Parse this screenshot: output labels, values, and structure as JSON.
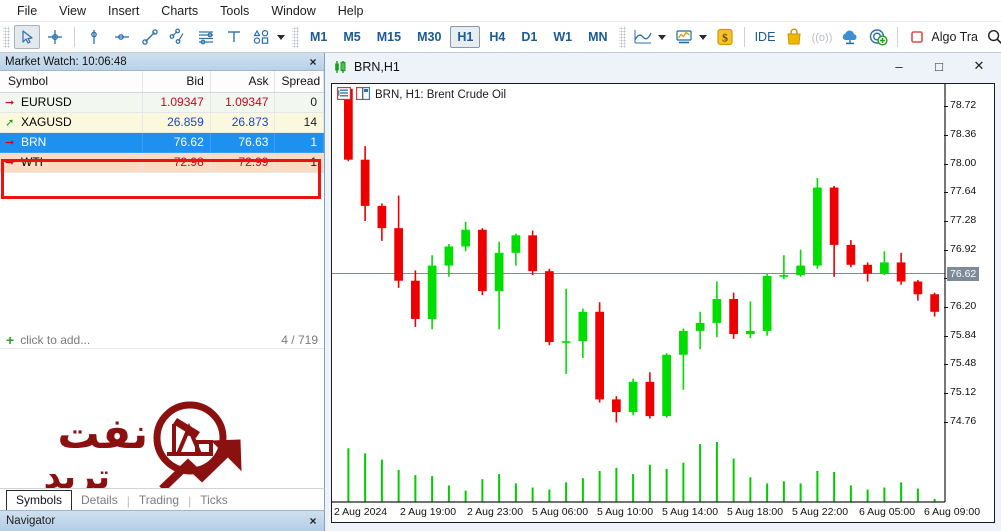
{
  "menubar": {
    "items": [
      {
        "label": "File",
        "name": "menu-file"
      },
      {
        "label": "View",
        "name": "menu-view"
      },
      {
        "label": "Insert",
        "name": "menu-insert"
      },
      {
        "label": "Charts",
        "name": "menu-charts"
      },
      {
        "label": "Tools",
        "name": "menu-tools"
      },
      {
        "label": "Window",
        "name": "menu-window"
      },
      {
        "label": "Help",
        "name": "menu-help"
      }
    ]
  },
  "toolbar": {
    "cursor_tools": [
      "cursor-arrow-icon",
      "crosshair-icon"
    ],
    "object_tools": [
      "vertical-line-icon",
      "horizontal-line-icon",
      "trendline-icon",
      "equidistant-channel-icon",
      "fibonacci-icon",
      "text-label-icon",
      "shapes-icon"
    ],
    "timeframes": [
      {
        "label": "M1",
        "active": false
      },
      {
        "label": "M5",
        "active": false
      },
      {
        "label": "M15",
        "active": false
      },
      {
        "label": "M30",
        "active": false
      },
      {
        "label": "H1",
        "active": true
      },
      {
        "label": "H4",
        "active": false
      },
      {
        "label": "D1",
        "active": false
      },
      {
        "label": "W1",
        "active": false
      },
      {
        "label": "MN",
        "active": false
      }
    ],
    "ide_label": "IDE",
    "algo_label": "Algo Tra",
    "dollar_label": "$",
    "icons": [
      "chart-type-icon",
      "indicators-icon",
      "dollar-icon",
      "market-bag-icon",
      "signals-icon",
      "cloud-icon",
      "vps-icon",
      "algo-trading-icon",
      "search-icon"
    ]
  },
  "market_watch": {
    "title": "Market Watch: 10:06:48",
    "close_label": "×",
    "columns": [
      "Symbol",
      "Bid",
      "Ask",
      "Spread"
    ],
    "rows": [
      {
        "trend": "down",
        "symbol": "EURUSD",
        "bid": "1.09347",
        "ask": "1.09347",
        "spread": "0",
        "style": "row-a",
        "value_color": "red"
      },
      {
        "trend": "up",
        "symbol": "XAGUSD",
        "bid": "26.859",
        "ask": "26.873",
        "spread": "14",
        "style": "row-b",
        "value_color": "blue"
      },
      {
        "trend": "down",
        "symbol": "BRN",
        "bid": "76.62",
        "ask": "76.63",
        "spread": "1",
        "style": "row-sel",
        "value_color": "white"
      },
      {
        "trend": "down",
        "symbol": "WTI",
        "bid": "72.98",
        "ask": "72.99",
        "spread": "1",
        "style": "row-peach",
        "value_color": "red"
      }
    ],
    "add_label": "click to add...",
    "count_label": "4 / 719",
    "highlight_color": "#ee1111"
  },
  "watermark": {
    "text_top": "نفت",
    "text_bottom": "ترید",
    "color": "#8b1111",
    "icon": "oil-pump-jack-icon"
  },
  "left_tabs": {
    "tabs": [
      {
        "label": "Symbols",
        "active": true
      },
      {
        "label": "Details",
        "active": false
      },
      {
        "label": "Trading",
        "active": false
      },
      {
        "label": "Ticks",
        "active": false
      }
    ],
    "separator": "|"
  },
  "navigator": {
    "title": "Navigator",
    "close_label": "×"
  },
  "chart_window": {
    "title": "BRN,H1",
    "title_icon": "candlestick-icon",
    "minimize_label": "–",
    "maximize_label": "□",
    "close_label": "✕",
    "label": "BRN, H1:  Brent Crude Oil",
    "label_icons": [
      "data-window-icon",
      "chart-properties-icon"
    ]
  },
  "chart_data": {
    "type": "candlestick",
    "title": "BRN, H1:  Brent Crude Oil",
    "symbol": "BRN",
    "timeframe": "H1",
    "instrument": "Brent Crude Oil",
    "xlabel": "",
    "ylabel": "",
    "ylim": [
      74.58,
      78.9
    ],
    "grid": false,
    "current_price": 76.62,
    "current_price_line_color": "#7d8a99",
    "bull_color": "#00dd00",
    "bear_color": "#ee0000",
    "volume_color": "#00cc00",
    "y_ticks": [
      78.72,
      78.36,
      78.0,
      77.64,
      77.28,
      76.92,
      76.56,
      76.2,
      75.84,
      75.48,
      75.12,
      74.76
    ],
    "x_ticks": [
      "2 Aug 2024",
      "2 Aug 19:00",
      "2 Aug 23:00",
      "5 Aug 06:00",
      "5 Aug 10:00",
      "5 Aug 14:00",
      "5 Aug 18:00",
      "5 Aug 22:00",
      "6 Aug 05:00",
      "6 Aug 09:00"
    ],
    "candles": [
      {
        "o": 78.94,
        "h": 78.96,
        "l": 78.03,
        "c": 78.05,
        "v": 52
      },
      {
        "o": 78.05,
        "h": 78.22,
        "l": 77.28,
        "c": 77.47,
        "v": 47
      },
      {
        "o": 77.47,
        "h": 77.5,
        "l": 77.03,
        "c": 77.19,
        "v": 41
      },
      {
        "o": 77.19,
        "h": 77.6,
        "l": 76.44,
        "c": 76.53,
        "v": 31
      },
      {
        "o": 76.53,
        "h": 76.66,
        "l": 75.95,
        "c": 76.05,
        "v": 26
      },
      {
        "o": 76.05,
        "h": 76.85,
        "l": 75.92,
        "c": 76.72,
        "v": 25
      },
      {
        "o": 76.72,
        "h": 76.99,
        "l": 76.58,
        "c": 76.96,
        "v": 16
      },
      {
        "o": 76.96,
        "h": 77.27,
        "l": 76.9,
        "c": 77.17,
        "v": 11
      },
      {
        "o": 77.17,
        "h": 77.19,
        "l": 76.35,
        "c": 76.4,
        "v": 22
      },
      {
        "o": 76.4,
        "h": 77.02,
        "l": 75.92,
        "c": 76.88,
        "v": 27
      },
      {
        "o": 76.88,
        "h": 77.12,
        "l": 76.72,
        "c": 77.1,
        "v": 18
      },
      {
        "o": 77.1,
        "h": 77.16,
        "l": 76.6,
        "c": 76.65,
        "v": 14
      },
      {
        "o": 76.65,
        "h": 76.68,
        "l": 75.72,
        "c": 75.76,
        "v": 12
      },
      {
        "o": 75.76,
        "h": 76.43,
        "l": 75.36,
        "c": 75.77,
        "v": 19
      },
      {
        "o": 75.77,
        "h": 76.18,
        "l": 75.56,
        "c": 76.14,
        "v": 23
      },
      {
        "o": 76.14,
        "h": 76.26,
        "l": 75.0,
        "c": 75.04,
        "v": 30
      },
      {
        "o": 75.04,
        "h": 75.08,
        "l": 74.75,
        "c": 74.88,
        "v": 33
      },
      {
        "o": 74.88,
        "h": 75.3,
        "l": 74.84,
        "c": 75.26,
        "v": 27
      },
      {
        "o": 75.26,
        "h": 75.38,
        "l": 74.8,
        "c": 74.83,
        "v": 36
      },
      {
        "o": 74.83,
        "h": 75.62,
        "l": 74.81,
        "c": 75.6,
        "v": 32
      },
      {
        "o": 75.6,
        "h": 75.93,
        "l": 75.16,
        "c": 75.9,
        "v": 38
      },
      {
        "o": 75.9,
        "h": 76.14,
        "l": 75.67,
        "c": 76.0,
        "v": 56
      },
      {
        "o": 76.0,
        "h": 76.52,
        "l": 75.82,
        "c": 76.3,
        "v": 58
      },
      {
        "o": 76.3,
        "h": 76.38,
        "l": 75.8,
        "c": 75.86,
        "v": 42
      },
      {
        "o": 75.86,
        "h": 76.27,
        "l": 75.81,
        "c": 75.9,
        "v": 24
      },
      {
        "o": 75.9,
        "h": 76.62,
        "l": 75.84,
        "c": 76.59,
        "v": 18
      },
      {
        "o": 76.59,
        "h": 76.85,
        "l": 76.55,
        "c": 76.6,
        "v": 20
      },
      {
        "o": 76.6,
        "h": 76.92,
        "l": 76.58,
        "c": 76.72,
        "v": 18
      },
      {
        "o": 76.72,
        "h": 77.82,
        "l": 76.68,
        "c": 77.7,
        "v": 30
      },
      {
        "o": 77.7,
        "h": 77.72,
        "l": 76.58,
        "c": 76.98,
        "v": 29
      },
      {
        "o": 76.98,
        "h": 77.04,
        "l": 76.7,
        "c": 76.73,
        "v": 16
      },
      {
        "o": 76.73,
        "h": 76.76,
        "l": 76.52,
        "c": 76.62,
        "v": 12
      },
      {
        "o": 76.62,
        "h": 76.9,
        "l": 76.6,
        "c": 76.76,
        "v": 14
      },
      {
        "o": 76.76,
        "h": 76.88,
        "l": 76.48,
        "c": 76.52,
        "v": 19
      },
      {
        "o": 76.52,
        "h": 76.54,
        "l": 76.28,
        "c": 76.36,
        "v": 13
      },
      {
        "o": 76.36,
        "h": 76.38,
        "l": 76.08,
        "c": 76.14,
        "v": 3
      }
    ]
  }
}
